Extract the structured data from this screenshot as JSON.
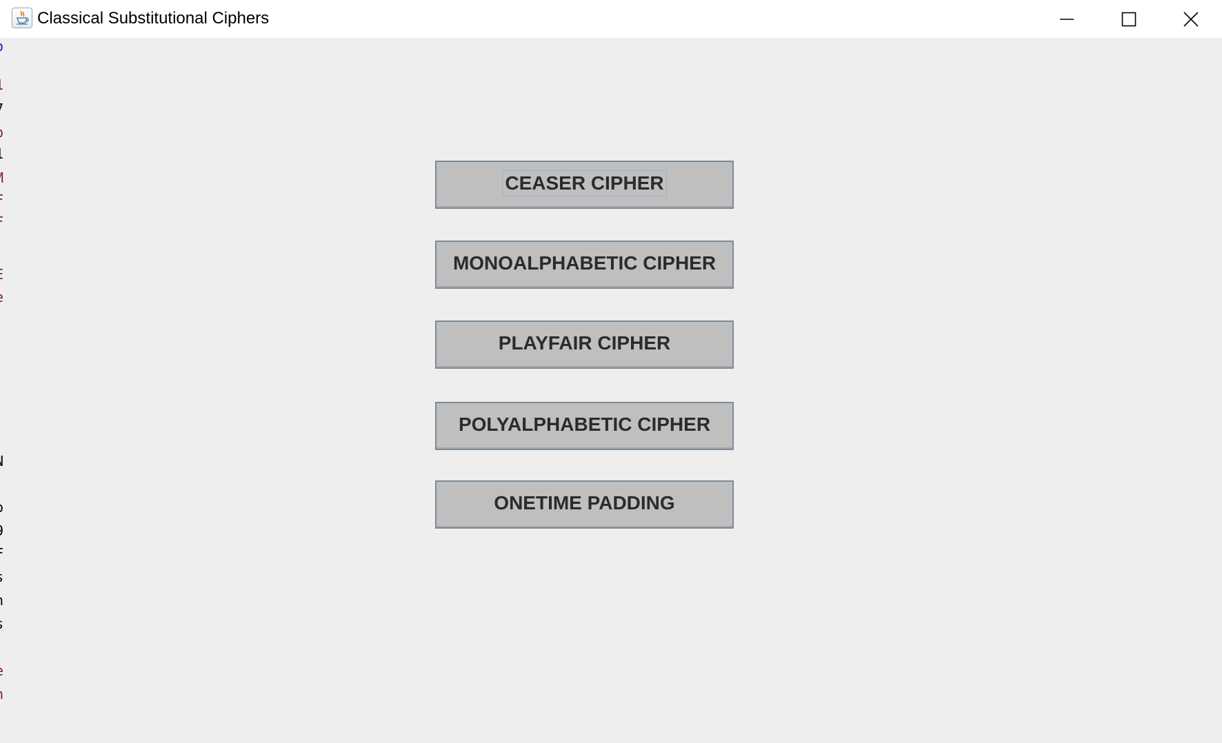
{
  "window": {
    "title": "Classical Substitutional Ciphers",
    "icon": "java-coffee-cup-icon"
  },
  "titlebar_controls": {
    "minimize_icon": "minimize-icon",
    "maximize_icon": "maximize-icon",
    "close_icon": "close-icon"
  },
  "background_strip": {
    "fragments": [
      "o",
      "1",
      "7",
      "p",
      "1",
      "M",
      "F",
      "F",
      "E",
      "e",
      "N",
      "o",
      "9",
      "F",
      "s",
      "n",
      "s",
      "e",
      "n"
    ]
  },
  "buttons": [
    {
      "label": "CEASER CIPHER",
      "focused": true
    },
    {
      "label": "MONOALPHABETIC CIPHER",
      "focused": false
    },
    {
      "label": "PLAYFAIR CIPHER",
      "focused": false
    },
    {
      "label": "POLYALPHABETIC CIPHER",
      "focused": false
    },
    {
      "label": "ONETIME PADDING",
      "focused": false
    }
  ],
  "colors": {
    "content_background": "#eeeeee",
    "button_fill": "#bfbfbf",
    "button_border": "#7a8a9a",
    "button_text": "#2b2b2b",
    "focus_ring": "#9bb2cc"
  }
}
